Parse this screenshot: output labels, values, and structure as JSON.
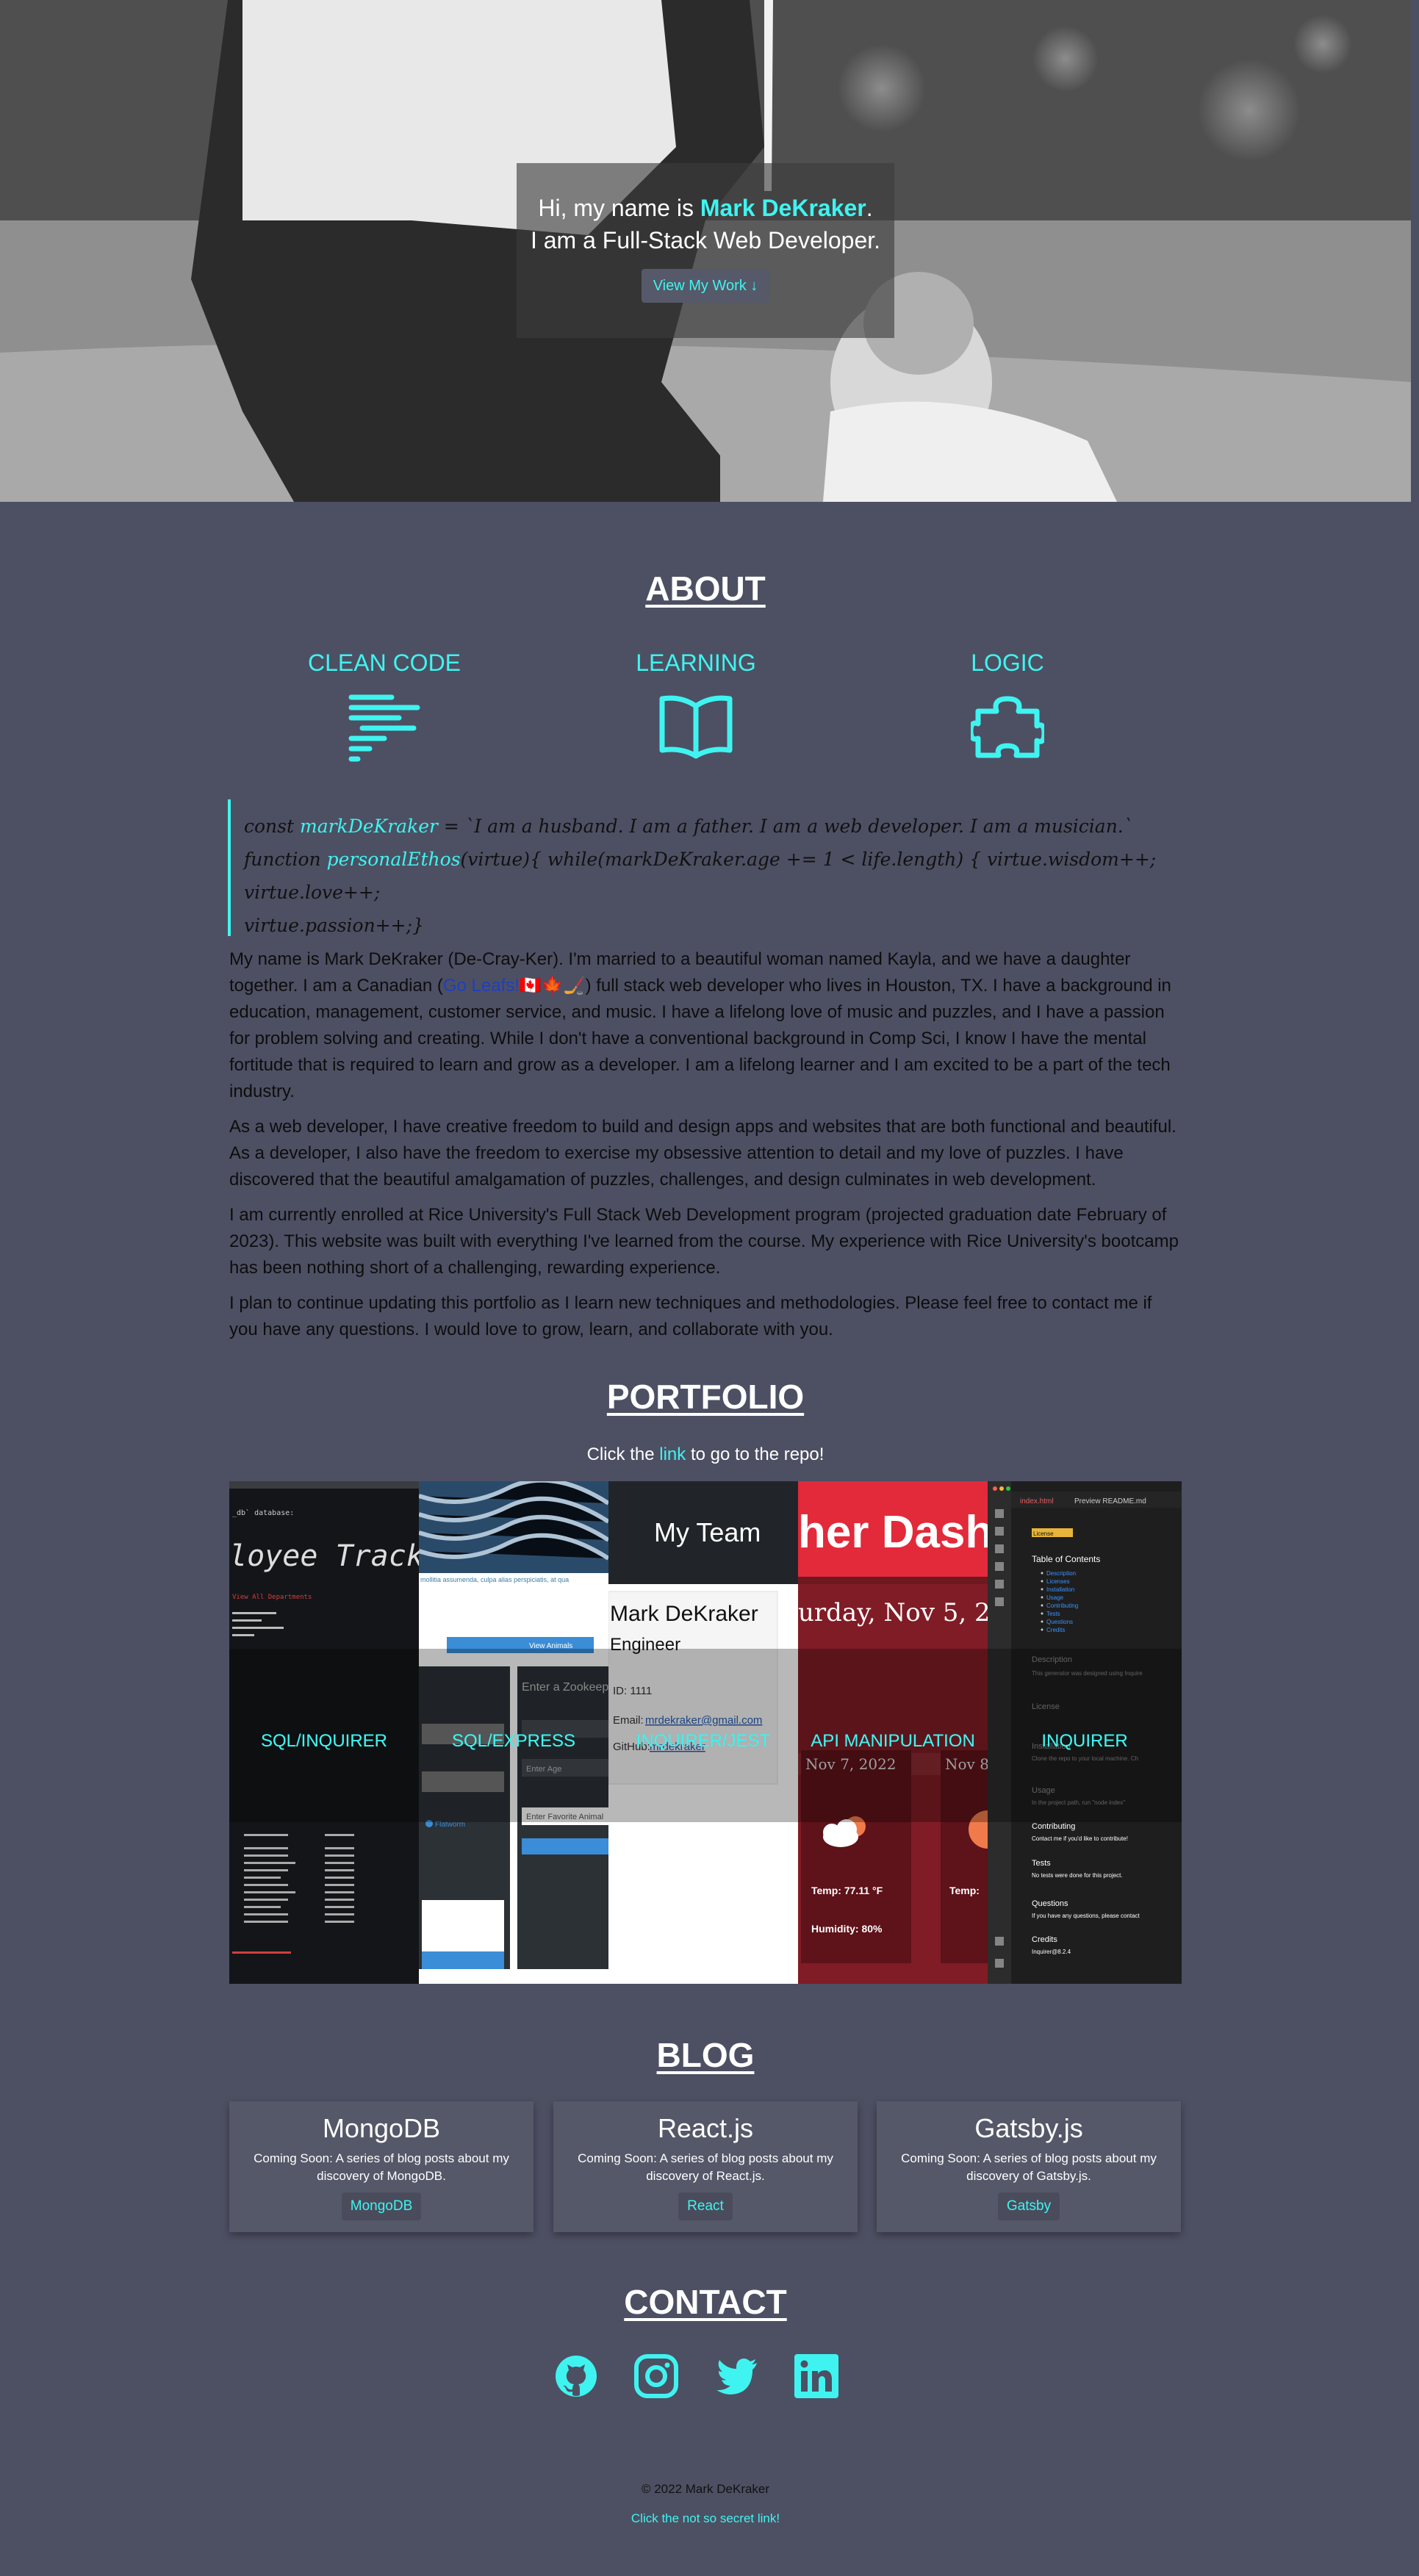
{
  "hero": {
    "greeting_prefix": "Hi, my name is ",
    "name": "Mark DeKraker",
    "greeting_suffix": ".",
    "tagline": "I am a Full-Stack Web Developer.",
    "cta": "View My Work ↓"
  },
  "about": {
    "title": "ABOUT",
    "pillars": [
      {
        "title": "CLEAN CODE",
        "icon": "code-lines-icon"
      },
      {
        "title": "LEARNING",
        "icon": "open-book-icon"
      },
      {
        "title": "LOGIC",
        "icon": "puzzle-piece-icon"
      }
    ],
    "code": {
      "l1_a": "const ",
      "l1_var": "markDeKraker",
      "l1_b": " = `I am a husband. I am a father. I am a web developer. I am a musician.`",
      "l2_a": "function ",
      "l2_fn": "personalEthos",
      "l2_b": "(virtue){ while(markDeKraker.age += 1 < life.length) { virtue.wisdom++; virtue.love++;",
      "l3": "virtue.passion++;}"
    },
    "p1_a": "My name is Mark DeKraker (De-Cray-Ker). I'm married to a beautiful woman named Kayla, and we have a daughter together. I am a Canadian (",
    "p1_link": "Go Leafs!",
    "p1_b": "🇨🇦🍁🏒) full stack web developer who lives in Houston, TX. I have a background in education, management, customer service, and music. I have a lifelong love of music and puzzles, and I have a passion for problem solving and creating. While I don't have a conventional background in Comp Sci, I know I have the mental fortitude that is required to learn and grow as a developer. I am a lifelong learner and I am excited to be a part of the tech industry.",
    "p2": "As a web developer, I have creative freedom to build and design apps and websites that are both functional and beautiful. As a developer, I also have the freedom to exercise my obsessive attention to detail and my love of puzzles. I have discovered that the beautiful amalgamation of puzzles, challenges, and design culminates in web development.",
    "p3": "I am currently enrolled at Rice University's Full Stack Web Development program (projected graduation date February of 2023). This website was built with everything I've learned from the course. My experience with Rice University's bootcamp has been nothing short of a challenging, rewarding experience.",
    "p4": "I plan to continue updating this portfolio as I learn new techniques and methodologies. Please feel free to contact me if you have any questions. I would love to grow, learn, and collaborate with you."
  },
  "portfolio": {
    "title": "PORTFOLIO",
    "sub_a": "Click the ",
    "sub_link": "link",
    "sub_b": " to go to the repo!",
    "projects": [
      {
        "label": "SQL/INQUIRER"
      },
      {
        "label": "SQL/EXPRESS"
      },
      {
        "label": "INQUIRER/JEST"
      },
      {
        "label": "API MANIPULATION"
      },
      {
        "label": "INQUIRER"
      }
    ],
    "shots": {
      "p1_code_hint": "_db` database:",
      "p1_ascii": "loyee Tracker",
      "p1_menu": "View All Departments",
      "p2_caption": "mollitia assumenda, culpa alias perspiciatis, at qua",
      "p2_btn": "View Animals",
      "p2_form_title": "Enter a Zookeeper",
      "p2_age": "Enter Age",
      "p2_animal": "Enter Favorite Animal",
      "p2_radio": "Flatworm",
      "p3_header": "My Team",
      "p3_name": "Mark DeKraker",
      "p3_role": "Engineer",
      "p3_id": "ID: 1111",
      "p3_email_label": "Email: ",
      "p3_email": "mrdekraker@gmail.com",
      "p3_github_label": "GitHub: ",
      "p3_github": "mrdekraker",
      "p4_banner": "her Dash",
      "p4_date": "urday, Nov 5, 2022",
      "p4_card_date": "Nov 7, 2022",
      "p4_card_date2": "Nov 8",
      "p4_temp": "Temp: 77.11 °F",
      "p4_temp2": "Temp:",
      "p4_hum": "Humidity: 80%",
      "p5_tab1": "index.html",
      "p5_tab2": "Preview README.md",
      "p5_license": "License",
      "p5_toc": "Table of Contents",
      "p5_toc_items": [
        "Description",
        "Licenses",
        "Installation",
        "Usage",
        "Contributing",
        "Tests",
        "Questions",
        "Credits"
      ],
      "p5_desc": "Description",
      "p5_desc_text": "This generator was designed using Inquire",
      "p5_lic": "License",
      "p5_inst": "Installation",
      "p5_inst_text": "Clone the repo to your local machine. Ch",
      "p5_usage": "Usage",
      "p5_usage_text": "In the project path, run \"node index\"",
      "p5_contrib": "Contributing",
      "p5_contrib_text": "Contact me if you'd like to contribute!",
      "p5_tests": "Tests",
      "p5_tests_text": "No tests were done for this project.",
      "p5_q": "Questions",
      "p5_q_text": "If you have any questions, please contact",
      "p5_credits": "Credits",
      "p5_credits_text": "Inquirer@8.2.4"
    }
  },
  "blog": {
    "title": "BLOG",
    "cards": [
      {
        "title": "MongoDB",
        "text": "Coming Soon: A series of blog posts about my discovery of MongoDB.",
        "btn": "MongoDB"
      },
      {
        "title": "React.js",
        "text": "Coming Soon: A series of blog posts about my discovery of React.js.",
        "btn": "React"
      },
      {
        "title": "Gatsby.js",
        "text": "Coming Soon: A series of blog posts about my discovery of Gatsby.js.",
        "btn": "Gatsby"
      }
    ]
  },
  "contact": {
    "title": "CONTACT",
    "icons": [
      "github-icon",
      "instagram-icon",
      "twitter-icon",
      "linkedin-icon"
    ]
  },
  "footer": {
    "copyright": "© 2022 Mark DeKraker",
    "secret": "Click the not so secret link!"
  },
  "colors": {
    "accent": "#3ff4f0",
    "background": "#4d5063",
    "card": "#555868"
  }
}
